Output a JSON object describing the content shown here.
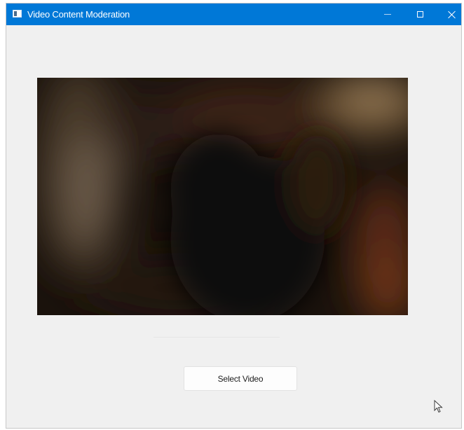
{
  "window": {
    "title": "Video Content Moderation",
    "icon": "app-window-icon",
    "controls": [
      "minimize-icon",
      "maximize-icon",
      "close-icon"
    ],
    "titlebar_color": "#0078d7",
    "background_color": "#f0f0f0"
  },
  "video": {
    "preview_icon": "video-preview"
  },
  "actions": {
    "select_video_label": "Select Video"
  },
  "pointer": {
    "icon": "mouse-cursor-icon"
  }
}
